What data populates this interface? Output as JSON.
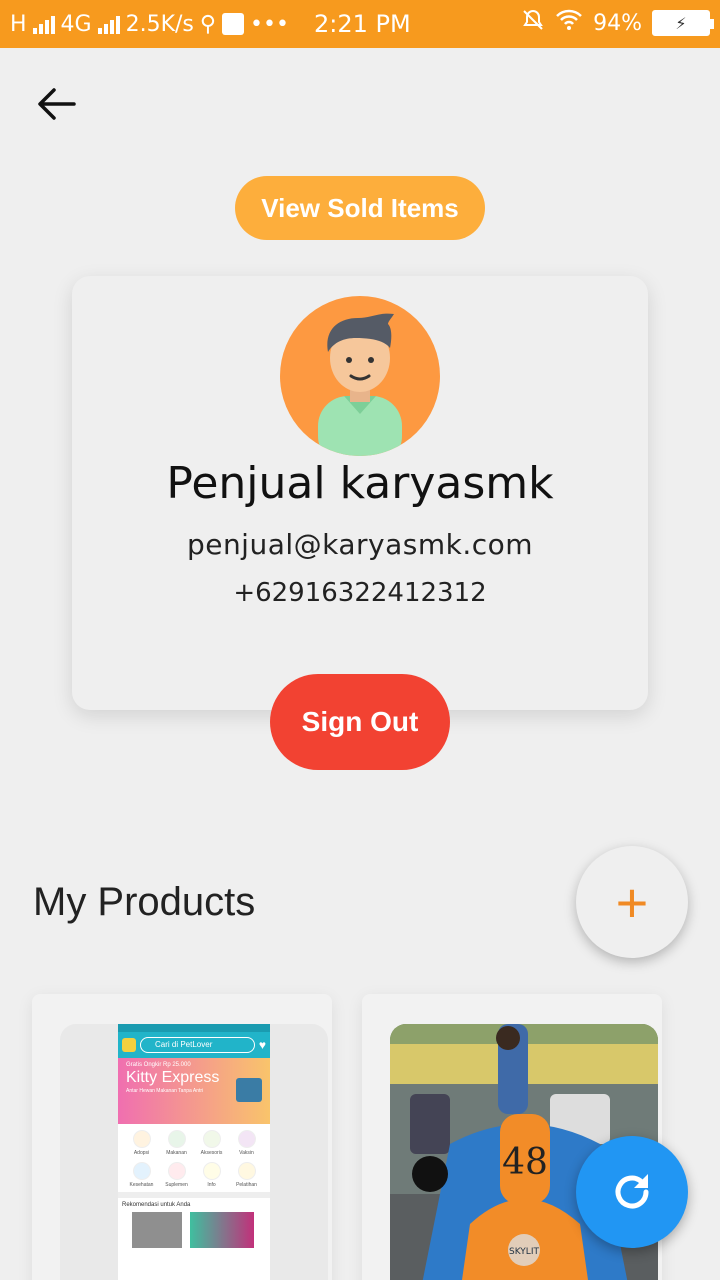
{
  "status_bar": {
    "network": "H",
    "network2": "4G",
    "speed": "2.5K/s",
    "time": "2:21 PM",
    "battery": "94%",
    "dots": "•••"
  },
  "actions": {
    "view_sold": "View Sold Items",
    "sign_out": "Sign Out"
  },
  "profile": {
    "name": "Penjual karyasmk",
    "email": "penjual@karyasmk.com",
    "phone": "+62916322412312"
  },
  "products_section": {
    "title": "My Products",
    "add_label": "+"
  },
  "products": [
    {
      "thumb": {
        "search_placeholder": "Cari di PetLover",
        "banner_small": "Gratis Ongkir Rp 25.000",
        "banner_title": "Kitty Express",
        "banner_sub": "Antar Hewan Makanan Tanpa Antri",
        "categories": [
          "Adopsi",
          "Makanan",
          "Aksesoris",
          "Vaksin",
          "Kesehatan",
          "Suplemen",
          "Info",
          "Pelatihan"
        ],
        "reco_label": "Rekomendasi untuk Anda"
      }
    },
    {
      "thumb": {
        "kart_number": "48",
        "kart_badge": "SKYLIT"
      }
    }
  ],
  "colors": {
    "status_bar": "#f79a1e",
    "view_sold": "#fdae3c",
    "sign_out": "#f24232",
    "refresh_fab": "#2196f3",
    "add_icon": "#f08a24"
  }
}
